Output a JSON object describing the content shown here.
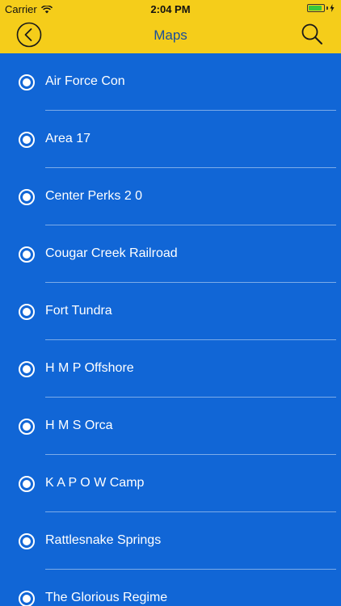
{
  "status_bar": {
    "carrier": "Carrier",
    "time": "2:04 PM",
    "battery_level": 0.9
  },
  "nav": {
    "title": "Maps"
  },
  "maps": [
    {
      "label": "Air Force Con"
    },
    {
      "label": "Area 17"
    },
    {
      "label": "Center Perks 2 0"
    },
    {
      "label": "Cougar Creek Railroad"
    },
    {
      "label": "Fort Tundra"
    },
    {
      "label": "H M P Offshore"
    },
    {
      "label": "H M S Orca"
    },
    {
      "label": "K A P O W Camp"
    },
    {
      "label": "Rattlesnake Springs"
    },
    {
      "label": "The Glorious Regime"
    }
  ],
  "colors": {
    "header_yellow": "#f5cd1a",
    "list_blue": "#1166d6",
    "title_blue": "#1a4f9a",
    "battery_green": "#38c83b"
  },
  "icons": {
    "back": "chevron-left-circle-icon",
    "search": "magnifier-icon",
    "wifi": "wifi-icon",
    "battery": "battery-icon",
    "charging": "bolt-icon",
    "radio": "radio-selected-icon"
  }
}
